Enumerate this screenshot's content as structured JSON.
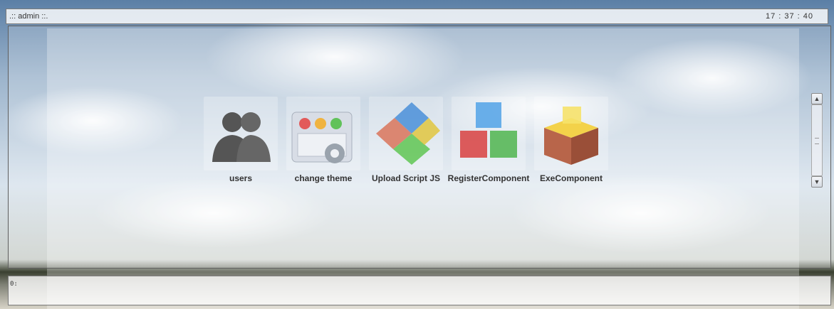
{
  "header": {
    "title": ".:: admin ::.",
    "clock": "17 : 37 : 40"
  },
  "desktop": {
    "icons": [
      {
        "label": "users",
        "icon": "users-icon"
      },
      {
        "label": "change theme",
        "icon": "change-theme-icon"
      },
      {
        "label": "Upload Script JS",
        "icon": "upload-script-icon"
      },
      {
        "label": "RegisterComponent",
        "icon": "register-component-icon"
      },
      {
        "label": "ExeComponent",
        "icon": "exe-component-icon"
      }
    ]
  },
  "scrollbar": {
    "up": "▲",
    "down": "▼"
  },
  "prompt": {
    "value": "0:"
  }
}
